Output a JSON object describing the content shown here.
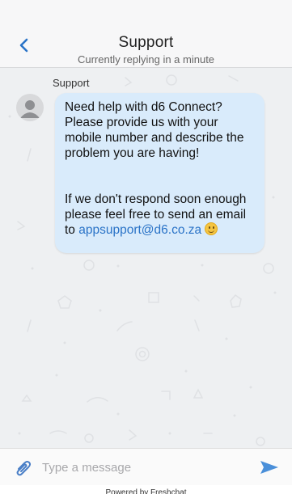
{
  "header": {
    "title": "Support",
    "subtitle": "Currently replying in a minute",
    "back_icon": "chevron-left-icon"
  },
  "chat": {
    "sender_name": "Support",
    "message": {
      "paragraph1": "Need help with d6 Connect? Please provide us with your mobile number and describe the problem you are having!",
      "paragraph2_text": "If we don't respond soon enough please feel free to send an email to",
      "email": "appsupport@d6.co.za",
      "emoji": "slightly-smiling-face-emoji"
    }
  },
  "composer": {
    "placeholder": "Type a message",
    "attach_icon": "paperclip-icon",
    "send_icon": "send-icon"
  },
  "footer": {
    "powered_by": "Powered by Freshchat"
  },
  "colors": {
    "accent": "#2a73c7",
    "bubble": "#d9ebfb",
    "background": "#eef0f2",
    "header_bg": "#f7f7f8"
  }
}
